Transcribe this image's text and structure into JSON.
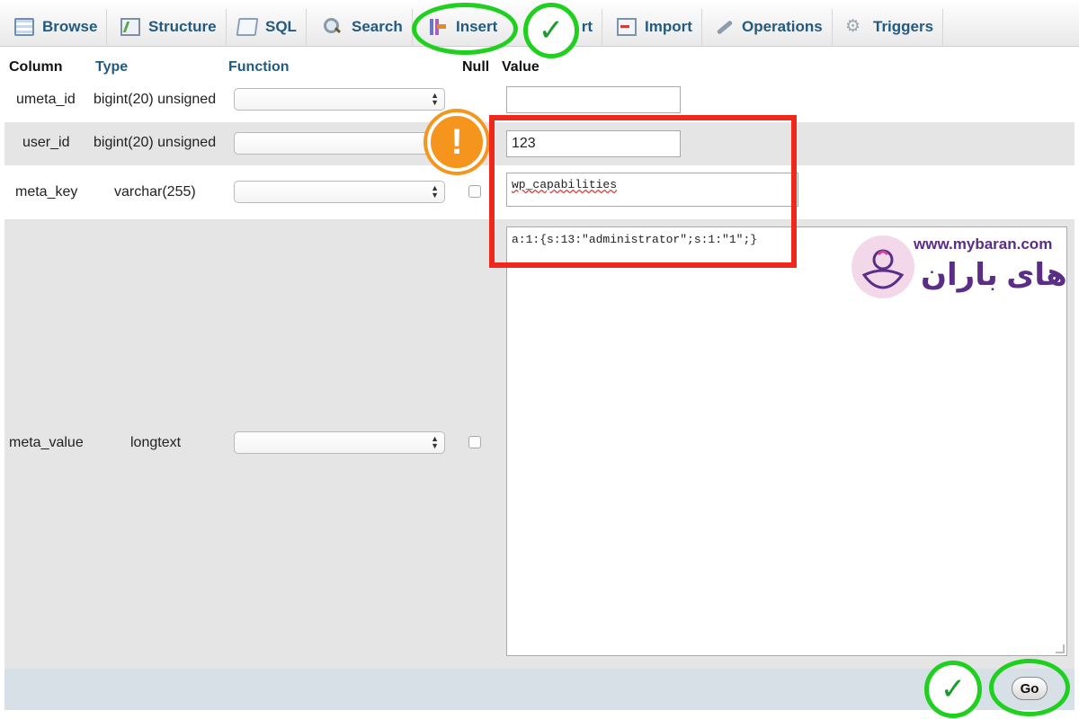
{
  "tabs": [
    {
      "label": "Browse",
      "icon": "browse-icon"
    },
    {
      "label": "Structure",
      "icon": "structure-icon"
    },
    {
      "label": "SQL",
      "icon": "sql-icon"
    },
    {
      "label": "Search",
      "icon": "search-icon"
    },
    {
      "label": "Insert",
      "icon": "insert-icon",
      "active": true
    },
    {
      "label": "Export",
      "icon": "export-icon"
    },
    {
      "label": "Import",
      "icon": "import-icon"
    },
    {
      "label": "Operations",
      "icon": "operations-icon"
    },
    {
      "label": "Triggers",
      "icon": "triggers-icon"
    }
  ],
  "export_tail": "rt",
  "headers": {
    "column": "Column",
    "type": "Type",
    "function": "Function",
    "null": "Null",
    "value": "Value"
  },
  "rows": [
    {
      "column": "umeta_id",
      "type": "bigint(20) unsigned",
      "function": "",
      "value": ""
    },
    {
      "column": "user_id",
      "type": "bigint(20) unsigned",
      "function": "",
      "value": "123"
    },
    {
      "column": "meta_key",
      "type": "varchar(255)",
      "function": "",
      "null": false,
      "value": "wp_capabilities"
    },
    {
      "column": "meta_value",
      "type": "longtext",
      "function": "",
      "null": false,
      "value": "a:1:{s:13:\"administrator\";s:1:\"1\";}"
    }
  ],
  "go_label": "Go",
  "watermark": {
    "url": "www.mybaran.com",
    "name": "های باران"
  },
  "colors": {
    "ring": "#1fd01f",
    "check": "#1a9b2b",
    "warn": "#f5951d",
    "highlight": "#f0281b",
    "link": "#235a81"
  },
  "annotations": {
    "warning_glyph": "!",
    "check_glyph": "✓"
  }
}
